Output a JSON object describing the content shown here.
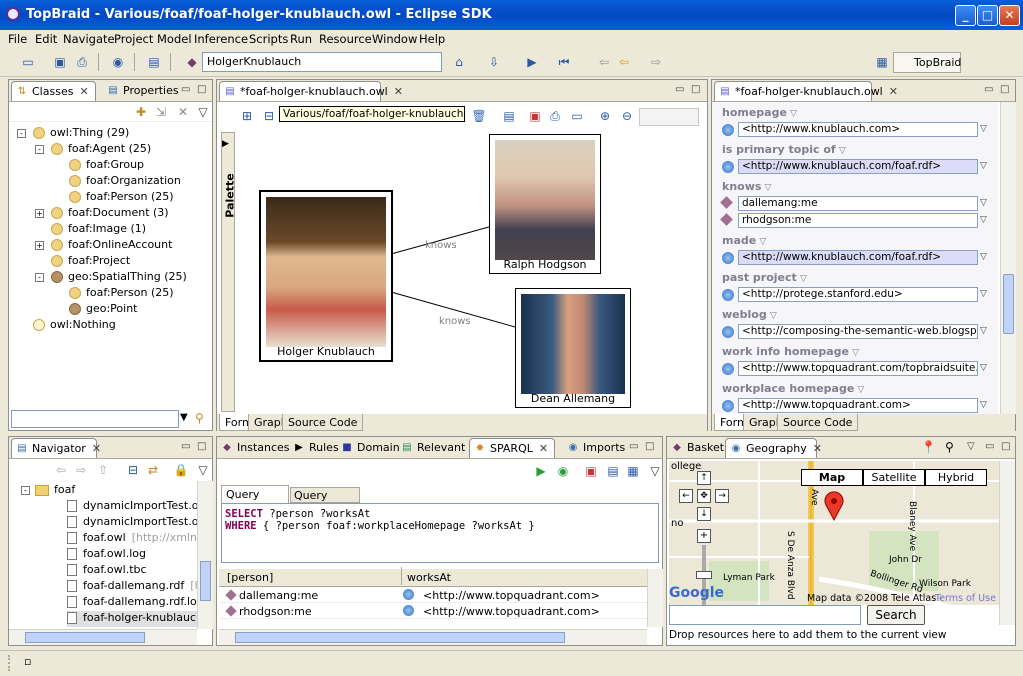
{
  "window": {
    "title": "TopBraid - Various/foaf/foaf-holger-knublauch.owl - Eclipse SDK"
  },
  "menu": [
    "File",
    "Edit",
    "Navigate",
    "Project",
    "Model",
    "Inference",
    "Scripts",
    "Run",
    "Resource",
    "Window",
    "Help"
  ],
  "toolbar": {
    "resource_field": "HolgerKnublauch",
    "perspective": "TopBraid"
  },
  "classes_view": {
    "tabs": [
      "Classes",
      "Properties"
    ],
    "tree": [
      {
        "label": "owl:Thing  (29)",
        "depth": 0,
        "expand": "-"
      },
      {
        "label": "foaf:Agent  (25)",
        "depth": 1,
        "expand": "-"
      },
      {
        "label": "foaf:Group",
        "depth": 2,
        "expand": ""
      },
      {
        "label": "foaf:Organization",
        "depth": 2,
        "expand": ""
      },
      {
        "label": "foaf:Person  (25)",
        "depth": 2,
        "expand": ""
      },
      {
        "label": "foaf:Document  (3)",
        "depth": 1,
        "expand": "+"
      },
      {
        "label": "foaf:Image  (1)",
        "depth": 1,
        "expand": ""
      },
      {
        "label": "foaf:OnlineAccount",
        "depth": 1,
        "expand": "+"
      },
      {
        "label": "foaf:Project",
        "depth": 1,
        "expand": ""
      },
      {
        "label": "geo:SpatialThing  (25)",
        "depth": 1,
        "expand": "-"
      },
      {
        "label": "foaf:Person  (25)",
        "depth": 2,
        "expand": ""
      },
      {
        "label": "geo:Point",
        "depth": 2,
        "expand": ""
      },
      {
        "label": "owl:Nothing",
        "depth": 0,
        "expand": ""
      }
    ]
  },
  "graph_editor": {
    "tab": "*foaf-holger-knublauch.owl",
    "tooltip": "Various/foaf/foaf-holger-knublauch.owl",
    "palette": "Palette",
    "nodes": {
      "holger": "Holger Knublauch",
      "ralph": "Ralph Hodgson",
      "dean": "Dean Allemang"
    },
    "edge_label": "knows",
    "bottom_tabs": [
      "Form",
      "Graph",
      "Source Code"
    ]
  },
  "form_editor": {
    "tab": "*foaf-holger-knublauch.owl",
    "fields": [
      {
        "label": "homepage",
        "values": [
          "<http://www.knublauch.com>"
        ]
      },
      {
        "label": "is primary topic of",
        "values": [
          "<http://www.knublauch.com/foaf.rdf>"
        ]
      },
      {
        "label": "knows",
        "values": [
          "dallemang:me",
          "rhodgson:me"
        ]
      },
      {
        "label": "made",
        "values": [
          "<http://www.knublauch.com/foaf.rdf>"
        ]
      },
      {
        "label": "past project",
        "values": [
          "<http://protege.stanford.edu>"
        ]
      },
      {
        "label": "weblog",
        "values": [
          "<http://composing-the-semantic-web.blogspot.com/>"
        ]
      },
      {
        "label": "work info homepage",
        "values": [
          "<http://www.topquadrant.com/topbraidsuite.html>"
        ]
      },
      {
        "label": "workplace homepage",
        "values": [
          "<http://www.topquadrant.com>"
        ]
      }
    ],
    "bottom_tabs": [
      "Form",
      "Graph",
      "Source Code"
    ]
  },
  "navigator": {
    "tab": "Navigator",
    "folder": "foaf",
    "files": [
      {
        "name": "dynamicImportTest.owl",
        "hint": ""
      },
      {
        "name": "dynamicImportTest.owl.",
        "hint": ""
      },
      {
        "name": "foaf.owl",
        "hint": "[http://xmlns"
      },
      {
        "name": "foaf.owl.log",
        "hint": ""
      },
      {
        "name": "foaf.owl.tbc",
        "hint": ""
      },
      {
        "name": "foaf-dallemang.rdf",
        "hint": "[ht"
      },
      {
        "name": "foaf-dallemang.rdf.log",
        "hint": ""
      },
      {
        "name": "foaf-holger-knublauch.o",
        "hint": ""
      }
    ]
  },
  "sparql_view": {
    "tabs": [
      "Instances",
      "Rules",
      "Domain",
      "Relevant P",
      "SPARQL",
      "Imports"
    ],
    "subtabs": [
      "Query Editor",
      "Query Library"
    ],
    "query_line1_kw": "SELECT",
    "query_line1": " ?person ?worksAt",
    "query_line2_kw": "WHERE",
    "query_line2": " { ?person foaf:workplaceHomepage ?worksAt }",
    "columns": [
      "[person]",
      "worksAt"
    ],
    "rows": [
      {
        "person": "dallemang:me",
        "worksAt": "<http://www.topquadrant.com>"
      },
      {
        "person": "rhodgson:me",
        "worksAt": "<http://www.topquadrant.com>"
      }
    ]
  },
  "geography_view": {
    "tabs": [
      "Basket",
      "Geography"
    ],
    "map_buttons": [
      "Map",
      "Satellite",
      "Hybrid"
    ],
    "street_labels": [
      "ollege",
      "no",
      "S De Anza Blvd",
      "Blaney Ave",
      "John Dr",
      "Bollinger Rd",
      "Wilson Park",
      "Lyman Park",
      "Ave"
    ],
    "attribution": "Map data ©2008 Tele Atlas -",
    "terms": "Terms of Use",
    "search_button": "Search",
    "drop_hint": "Drop resources here to add them to the current view"
  }
}
